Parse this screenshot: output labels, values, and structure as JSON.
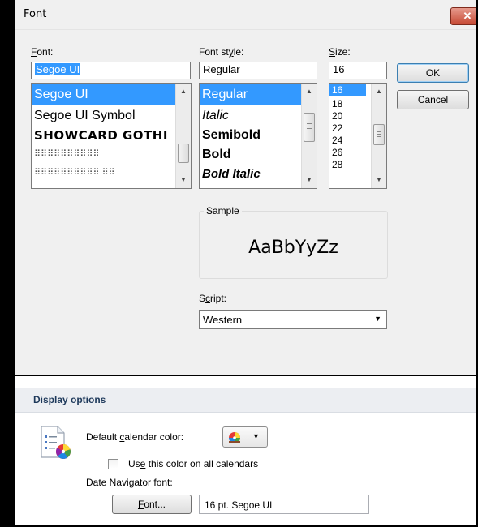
{
  "dialog": {
    "title": "Font",
    "close_glyph": "✕",
    "font_label_first": "F",
    "font_label_rest": "ont:",
    "style_label_pre": "Font st",
    "style_label_u": "y",
    "style_label_post": "le:",
    "size_label_first": "S",
    "size_label_rest": "ize:",
    "font_value": "Segoe UI",
    "style_value": "Regular",
    "size_value": "16",
    "font_list": [
      "Segoe UI",
      "Segoe UI Symbol",
      "SHOWCARD GOTHI",
      "⠿⠿⠿⠿⠿⠿⠿⠿⠿⠿",
      "⠿⠿⠿⠿⠿⠿⠿⠿⠿⠿ ⠿⠿"
    ],
    "style_list": [
      "Regular",
      "Italic",
      "Semibold",
      "Bold",
      "Bold Italic"
    ],
    "size_list": [
      "16",
      "18",
      "20",
      "22",
      "24",
      "26",
      "28"
    ],
    "ok_label": "OK",
    "cancel_label": "Cancel",
    "sample_label": "Sample",
    "sample_text": "AaBbYyZz",
    "script_label_pre": "S",
    "script_label_u": "c",
    "script_label_post": "ript:",
    "script_value": "Western"
  },
  "panel": {
    "title": "Display options",
    "calendar_color_pre": "Default ",
    "calendar_color_u": "c",
    "calendar_color_post": "alendar color:",
    "checkbox_pre": "Us",
    "checkbox_u": "e",
    "checkbox_post": " this color on all calendars",
    "checkbox_checked": false,
    "nav_font_label": "Date Navigator font:",
    "font_button_u": "F",
    "font_button_rest": "ont...",
    "font_value": "16 pt. Segoe UI"
  },
  "icons": [
    "close-icon",
    "calendar-color-icon",
    "color-wheel-icon",
    "chevron-down-icon"
  ]
}
